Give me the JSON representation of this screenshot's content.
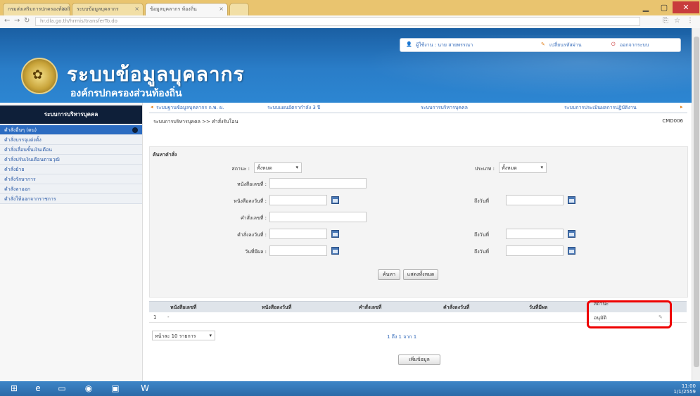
{
  "browser": {
    "tabs": [
      {
        "label": "กรมส่งเสริมการปกครองท้องถิ่น"
      },
      {
        "label": "ระบบข้อมูลบุคลากร"
      },
      {
        "label": "ข้อมูลบุคลากร ท้องถิ่น"
      }
    ],
    "url": "hr.dla.go.th/hrmis/transferTo.do"
  },
  "header": {
    "title": "ระบบข้อมูลบุคลากร",
    "subtitle": "องค์กรปกครองส่วนท้องถิ่น",
    "user_label": "ผู้ใช้งาน : นาย สายพรรณา",
    "change_password": "เปลี่ยนรหัสผ่าน",
    "logout": "ออกจากระบบ"
  },
  "sidebar": {
    "title": "ระบบการบริหารบุคคล",
    "items": [
      {
        "label": "คำสั่งอื่นๆ (ตน)"
      },
      {
        "label": "คำสั่งบรรจุแต่งตั้ง"
      },
      {
        "label": "คำสั่งเลื่อนขั้นเงินเดือน"
      },
      {
        "label": "คำสั่งปรับเงินเดือนตามวุฒิ"
      },
      {
        "label": "คำสั่งย้าย"
      },
      {
        "label": "คำสั่งรักษาการ"
      },
      {
        "label": "คำสั่งลาออก"
      },
      {
        "label": "คำสั่งให้ออกจากราชการ"
      }
    ]
  },
  "topnav": {
    "items": [
      {
        "label": "ระบบฐานข้อมูลบุคลากร ก.พ. ผ."
      },
      {
        "label": "ระบบแผนอัตรากำลัง 3 ปี"
      },
      {
        "label": "ระบบการบริหารบุคคล"
      },
      {
        "label": "ระบบการประเมินผลการปฏิบัติงาน"
      }
    ]
  },
  "breadcrumb": "ระบบการบริหารบุคคล >> คำสั่งรับโอน",
  "page_code": "CMD006",
  "search": {
    "heading": "ค้นหาคำสั่ง",
    "status_label": "สถานะ :",
    "status_value": "ทั้งหมด",
    "type_label": "ประเภท :",
    "type_value": "ทั้งหมด",
    "order_no_label": "หนังสือเลขที่ :",
    "order_date_label": "หนังสือลงวันที่ :",
    "to_date_label_1": "ถึงวันที่",
    "cmd_no_label": "คำสั่งเลขที่ :",
    "cmd_date_label": "คำสั่งลงวันที่ :",
    "to_date_label_2": "ถึงวันที่",
    "effective_label": "วันที่มีผล :",
    "to_date_label_3": "ถึงวันที่",
    "search_button": "ค้นหา",
    "reset_button": "แสดงทั้งหมด"
  },
  "results": {
    "headers": [
      "หนังสือเลขที่",
      "หนังสือลงวันที่",
      "คำสั่งเลขที่",
      "คำสั่งลงวันที่",
      "วันที่มีผล",
      "สถานะ"
    ],
    "rows": [
      {
        "index": "1",
        "order_no": "-",
        "status": "อนุมัติ"
      }
    ],
    "per_page": "หน้าละ 10 รายการ",
    "pager": "1 ถึง 1 จาก 1",
    "add_button": "เพิ่มข้อมูล"
  },
  "taskbar": {
    "time": "11:00",
    "date": "1/1/2559"
  },
  "colors": {
    "banner": "#2a7dc8",
    "sidebar_header": "#0e1f39",
    "highlight": "#ee0000"
  }
}
